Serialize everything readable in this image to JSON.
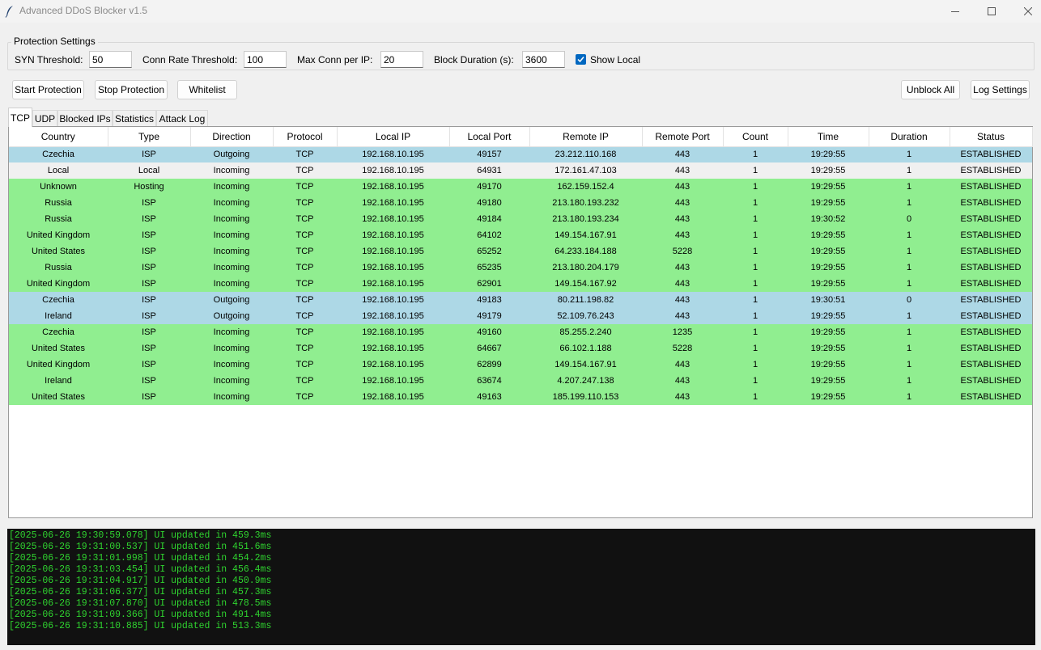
{
  "window": {
    "title": "Advanced DDoS Blocker v1.5"
  },
  "settings": {
    "title": "Protection Settings",
    "syn_label": "SYN Threshold:",
    "syn_value": "50",
    "conn_rate_label": "Conn Rate Threshold:",
    "conn_rate_value": "100",
    "max_conn_label": "Max Conn per IP:",
    "max_conn_value": "20",
    "block_duration_label": "Block Duration (s):",
    "block_duration_value": "3600",
    "show_local_label": "Show Local",
    "show_local_checked": true
  },
  "buttons": {
    "start": "Start Protection",
    "stop": "Stop Protection",
    "whitelist": "Whitelist",
    "unblock_all": "Unblock All",
    "log_settings": "Log Settings"
  },
  "tabs": [
    "TCP",
    "UDP",
    "Blocked IPs",
    "Statistics",
    "Attack Log"
  ],
  "active_tab": "TCP",
  "colors": {
    "outgoing": "#add8e6",
    "local": "#f0f0f0",
    "incoming": "#90ee90",
    "log_text": "#2fd32f",
    "log_bg": "#111111",
    "accent": "#0067c0"
  },
  "table": {
    "columns": [
      "Country",
      "Type",
      "Direction",
      "Protocol",
      "Local IP",
      "Local Port",
      "Remote IP",
      "Remote Port",
      "Count",
      "Time",
      "Duration",
      "Status"
    ],
    "rows": [
      [
        "Czechia",
        "ISP",
        "Outgoing",
        "TCP",
        "192.168.10.195",
        "49157",
        "23.212.110.168",
        "443",
        "1",
        "19:29:55",
        "1",
        "ESTABLISHED"
      ],
      [
        "Local",
        "Local",
        "Incoming",
        "TCP",
        "192.168.10.195",
        "64931",
        "172.161.47.103",
        "443",
        "1",
        "19:29:55",
        "1",
        "ESTABLISHED"
      ],
      [
        "Unknown",
        "Hosting",
        "Incoming",
        "TCP",
        "192.168.10.195",
        "49170",
        "162.159.152.4",
        "443",
        "1",
        "19:29:55",
        "1",
        "ESTABLISHED"
      ],
      [
        "Russia",
        "ISP",
        "Incoming",
        "TCP",
        "192.168.10.195",
        "49180",
        "213.180.193.232",
        "443",
        "1",
        "19:29:55",
        "1",
        "ESTABLISHED"
      ],
      [
        "Russia",
        "ISP",
        "Incoming",
        "TCP",
        "192.168.10.195",
        "49184",
        "213.180.193.234",
        "443",
        "1",
        "19:30:52",
        "0",
        "ESTABLISHED"
      ],
      [
        "United Kingdom",
        "ISP",
        "Incoming",
        "TCP",
        "192.168.10.195",
        "64102",
        "149.154.167.91",
        "443",
        "1",
        "19:29:55",
        "1",
        "ESTABLISHED"
      ],
      [
        "United States",
        "ISP",
        "Incoming",
        "TCP",
        "192.168.10.195",
        "65252",
        "64.233.184.188",
        "5228",
        "1",
        "19:29:55",
        "1",
        "ESTABLISHED"
      ],
      [
        "Russia",
        "ISP",
        "Incoming",
        "TCP",
        "192.168.10.195",
        "65235",
        "213.180.204.179",
        "443",
        "1",
        "19:29:55",
        "1",
        "ESTABLISHED"
      ],
      [
        "United Kingdom",
        "ISP",
        "Incoming",
        "TCP",
        "192.168.10.195",
        "62901",
        "149.154.167.92",
        "443",
        "1",
        "19:29:55",
        "1",
        "ESTABLISHED"
      ],
      [
        "Czechia",
        "ISP",
        "Outgoing",
        "TCP",
        "192.168.10.195",
        "49183",
        "80.211.198.82",
        "443",
        "1",
        "19:30:51",
        "0",
        "ESTABLISHED"
      ],
      [
        "Ireland",
        "ISP",
        "Outgoing",
        "TCP",
        "192.168.10.195",
        "49179",
        "52.109.76.243",
        "443",
        "1",
        "19:29:55",
        "1",
        "ESTABLISHED"
      ],
      [
        "Czechia",
        "ISP",
        "Incoming",
        "TCP",
        "192.168.10.195",
        "49160",
        "85.255.2.240",
        "1235",
        "1",
        "19:29:55",
        "1",
        "ESTABLISHED"
      ],
      [
        "United States",
        "ISP",
        "Incoming",
        "TCP",
        "192.168.10.195",
        "64667",
        "66.102.1.188",
        "5228",
        "1",
        "19:29:55",
        "1",
        "ESTABLISHED"
      ],
      [
        "United Kingdom",
        "ISP",
        "Incoming",
        "TCP",
        "192.168.10.195",
        "62899",
        "149.154.167.91",
        "443",
        "1",
        "19:29:55",
        "1",
        "ESTABLISHED"
      ],
      [
        "Ireland",
        "ISP",
        "Incoming",
        "TCP",
        "192.168.10.195",
        "63674",
        "4.207.247.138",
        "443",
        "1",
        "19:29:55",
        "1",
        "ESTABLISHED"
      ],
      [
        "United States",
        "ISP",
        "Incoming",
        "TCP",
        "192.168.10.195",
        "49163",
        "185.199.110.153",
        "443",
        "1",
        "19:29:55",
        "1",
        "ESTABLISHED"
      ]
    ]
  },
  "log": [
    "[2025-06-26 19:30:59.078] UI updated in 459.3ms",
    "[2025-06-26 19:31:00.537] UI updated in 451.6ms",
    "[2025-06-26 19:31:01.998] UI updated in 454.2ms",
    "[2025-06-26 19:31:03.454] UI updated in 456.4ms",
    "[2025-06-26 19:31:04.917] UI updated in 450.9ms",
    "[2025-06-26 19:31:06.377] UI updated in 457.3ms",
    "[2025-06-26 19:31:07.870] UI updated in 478.5ms",
    "[2025-06-26 19:31:09.366] UI updated in 491.4ms",
    "[2025-06-26 19:31:10.885] UI updated in 513.3ms"
  ]
}
